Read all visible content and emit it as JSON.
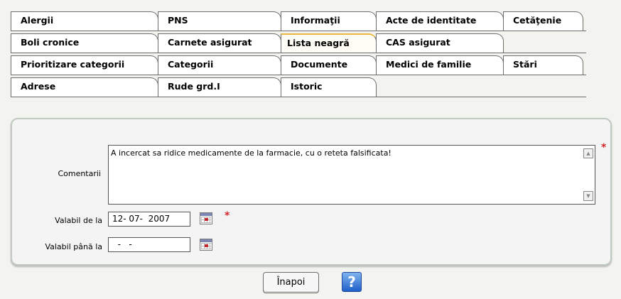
{
  "tabs": {
    "rows": [
      [
        "Alergii",
        "PNS",
        "Informaţii",
        "Acte de identitate",
        "Cetăţenie"
      ],
      [
        "Boli cronice",
        "Carnete asigurat",
        "Lista neagră",
        "CAS asigurat"
      ],
      [
        "Prioritizare categorii",
        "Categorii",
        "Documente",
        "Medici de familie",
        "Stări"
      ],
      [
        "Adrese",
        "Rude grd.I",
        "Istoric"
      ]
    ],
    "active": "Lista neagră"
  },
  "form": {
    "comment_label": "Comentarii",
    "comment_value": "A incercat sa ridice medicamente de la farmacie, cu o reteta falsificata!",
    "valid_from_label": "Valabil de la",
    "valid_from_value": "12- 07-  2007",
    "valid_to_label": "Valabil până la",
    "valid_to_value": "  -   -",
    "required_mark": "*"
  },
  "footer": {
    "back_button": "Înapoi",
    "help_button": "?"
  },
  "colors": {
    "required": "#d4242a",
    "active_tab_accent": "#e9b73b",
    "help_button": "#2f73d6"
  }
}
